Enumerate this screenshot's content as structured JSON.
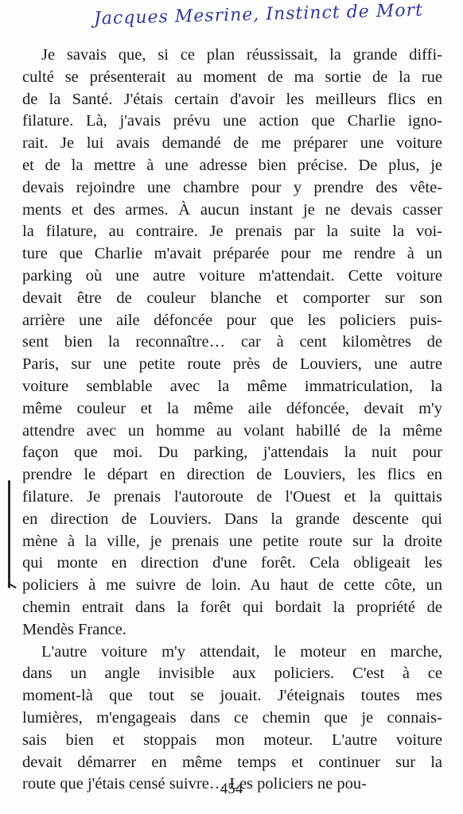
{
  "annotation": "Jacques Mesrine, Instinct de Mort",
  "paragraphs": [
    {
      "lines": [
        "Je savais que, si ce plan réussissait, la grande diffi-",
        "culté se présenterait au moment de ma sortie de la rue",
        "de la Santé. J'étais certain d'avoir les meilleurs flics en",
        "filature. Là, j'avais prévu une action que Charlie igno-",
        "rait. Je lui avais demandé de me préparer une voiture",
        "et de la mettre à une adresse bien précise. De plus, je",
        "devais rejoindre une chambre pour y prendre des vête-",
        "ments et des armes. À aucun instant je ne devais casser",
        "la filature, au contraire. Je prenais par la suite la voi-",
        "ture que Charlie m'avait préparée pour me rendre à un",
        "parking où une autre voiture m'attendait. Cette voiture",
        "devait être de couleur blanche et comporter sur son",
        "arrière une aile défoncée pour que les policiers puis-",
        "sent bien la reconnaître… car à cent kilomètres de",
        "Paris, sur une petite route près de Louviers, une autre",
        "voiture semblable avec la même immatriculation, la",
        "même couleur et la même aile défoncée, devait m'y",
        "attendre avec un homme au volant habillé de la même",
        "façon que moi. Du parking, j'attendais la nuit pour",
        "prendre le départ en direction de Louviers, les flics en",
        "filature. Je prenais l'autoroute de l'Ouest et la quittais",
        "en direction de Louviers. Dans la grande descente qui",
        "mène à la ville, je prenais une petite route sur la droite",
        "qui monte en direction d'une forêt. Cela obligeait les",
        "policiers à me suivre de loin. Au haut de cette côte, un",
        "chemin entrait dans la forêt qui bordait la propriété de",
        "Mendès France."
      ]
    },
    {
      "lines": [
        "L'autre voiture m'y attendait, le moteur en marche,",
        "dans un angle invisible aux policiers. C'est à ce",
        "moment-là que tout se jouait. J'éteignais toutes mes",
        "lumières, m'engageais dans ce chemin que je connais-",
        "sais bien et stoppais mon moteur. L'autre voiture",
        "devait démarrer en même temps et continuer sur la",
        "route que j'étais censé suivre… Les policiers ne pou-"
      ]
    }
  ],
  "page_number": "454"
}
